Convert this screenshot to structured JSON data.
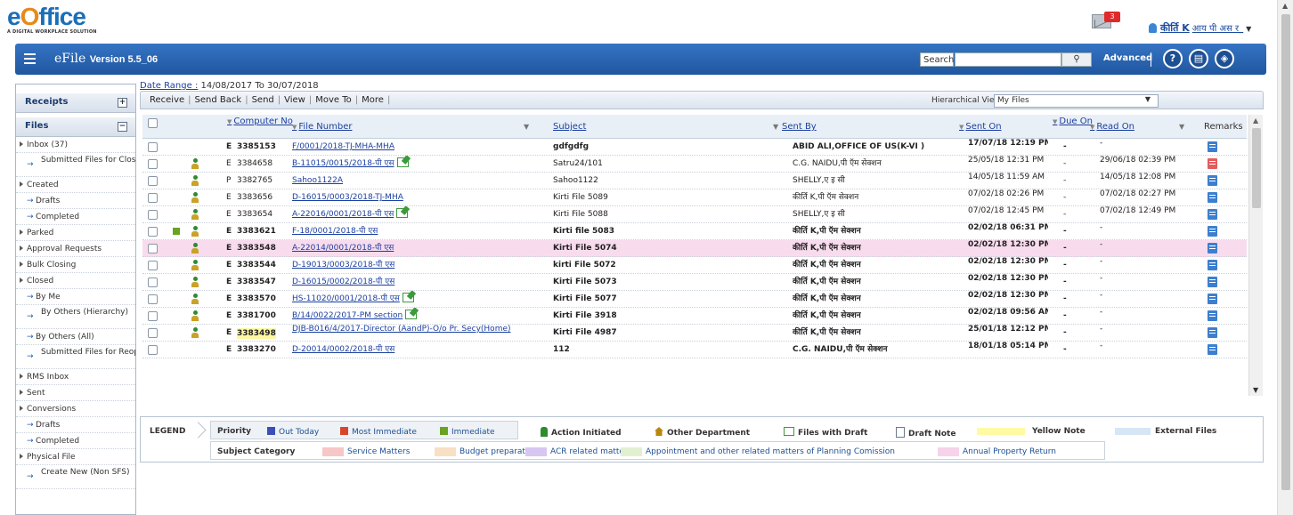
{
  "header": {
    "logo_text_e": "e",
    "logo_text_o": "O",
    "logo_text_rest": "ffice",
    "logo_tagline": "A DIGITAL WORKPLACE SOLUTION",
    "notification_count": "3",
    "user_name": "कीर्ति K",
    "user_designation": "आय पी अस र_"
  },
  "nav": {
    "app_name": "eFile",
    "version": "Version 5.5_06",
    "search_label": "Search",
    "search_value": "",
    "advanced_label": "Advanced",
    "help_icon": "?",
    "doc_icon": "▤",
    "box_icon": "◈"
  },
  "sidebar": {
    "receipts": "Receipts",
    "files": "Files",
    "items": [
      {
        "label": "Inbox (37)",
        "kind": "top"
      },
      {
        "label": "Submitted Files for Closing Approval",
        "kind": "sub2"
      },
      {
        "label": "Created",
        "kind": "top"
      },
      {
        "label": "Drafts",
        "kind": "sub"
      },
      {
        "label": "Completed",
        "kind": "sub"
      },
      {
        "label": "Parked",
        "kind": "top"
      },
      {
        "label": "Approval Requests",
        "kind": "top"
      },
      {
        "label": "Bulk Closing",
        "kind": "top"
      },
      {
        "label": "Closed",
        "kind": "top"
      },
      {
        "label": "By Me",
        "kind": "sub"
      },
      {
        "label": "By Others (Hierarchy)",
        "kind": "sub2"
      },
      {
        "label": "By Others (All)",
        "kind": "sub"
      },
      {
        "label": "Submitted Files for Reopening Approval",
        "kind": "sub2"
      },
      {
        "label": "RMS Inbox",
        "kind": "top"
      },
      {
        "label": "Sent",
        "kind": "top"
      },
      {
        "label": "Conversions",
        "kind": "top"
      },
      {
        "label": "Drafts",
        "kind": "sub"
      },
      {
        "label": "Completed",
        "kind": "sub"
      },
      {
        "label": "Physical File",
        "kind": "top"
      },
      {
        "label": "Create New (Non SFS)",
        "kind": "sub2"
      }
    ]
  },
  "filters": {
    "date_range_label": "Date Range :",
    "date_range_value": "14/08/2017 To 30/07/2018",
    "actions": [
      "Receive",
      "Send Back",
      "Send",
      "View",
      "Move To",
      "More"
    ],
    "hierarchical_label": "Hierarchical View",
    "hierarchical_value": "My Files"
  },
  "table": {
    "columns": {
      "computer_no": "Computer No",
      "file_number": "File Number",
      "subject": "Subject",
      "sent_by": "Sent By",
      "sent_on": "Sent On",
      "due_on": "Due On",
      "read_on": "Read On",
      "remarks": "Remarks"
    },
    "rows": [
      {
        "type": "E",
        "no": "3385153",
        "file": "F/0001/2018-TJ-MHA-MHA",
        "subject": "gdfgdfg",
        "sent_by": "ABID ALI,OFFICE OF US(K-VI )",
        "sent_on": "17/07/18 12:19 PM",
        "due": "-",
        "read": "-",
        "bold": true
      },
      {
        "type": "E",
        "no": "3384658",
        "file": "B-11015/0015/2018-पी एस",
        "subject": "Satru24/101",
        "sent_by": "C.G. NAIDU,पी ऍम सेक्शन",
        "sent_on": "25/05/18 12:31 PM",
        "due": "-",
        "read": "29/06/18 02:39 PM",
        "bold": false
      },
      {
        "type": "P",
        "no": "3382765",
        "file": "Sahoo1122A",
        "subject": "Sahoo1122",
        "sent_by": "SHELLY,ए इ सी",
        "sent_on": "14/05/18 11:59 AM",
        "due": "-",
        "read": "14/05/18 12:08 PM",
        "bold": false
      },
      {
        "type": "E",
        "no": "3383656",
        "file": "D-16015/0003/2018-TJ-MHA",
        "subject": "Kirti File 5089",
        "sent_by": "कीर्ति K,पी ऍम सेक्शन",
        "sent_on": "07/02/18 02:26 PM",
        "due": "-",
        "read": "07/02/18 02:27 PM",
        "bold": false
      },
      {
        "type": "E",
        "no": "3383654",
        "file": "A-22016/0001/2018-पी एस",
        "subject": "Kirti File 5088",
        "sent_by": "SHELLY,ए इ सी",
        "sent_on": "07/02/18 12:45 PM",
        "due": "-",
        "read": "07/02/18 12:49 PM",
        "bold": false
      },
      {
        "type": "E",
        "no": "3383621",
        "file": "F-18/0001/2018-पी एस",
        "subject": "Kirti file 5083",
        "sent_by": "कीर्ति K,पी ऍम सेक्शन",
        "sent_on": "02/02/18 06:31 PM",
        "due": "-",
        "read": "-",
        "bold": true
      },
      {
        "type": "E",
        "no": "3383548",
        "file": "A-22014/0001/2018-पी एस",
        "subject": "Kirti File 5074",
        "sent_by": "कीर्ति K,पी ऍम सेक्शन",
        "sent_on": "02/02/18 12:30 PM",
        "due": "-",
        "read": "-",
        "bold": true
      },
      {
        "type": "E",
        "no": "3383544",
        "file": "D-19013/0003/2018-पी एस",
        "subject": "kirti File 5072",
        "sent_by": "कीर्ति K,पी ऍम सेक्शन",
        "sent_on": "02/02/18 12:30 PM",
        "due": "-",
        "read": "-",
        "bold": true
      },
      {
        "type": "E",
        "no": "3383547",
        "file": "D-16015/0002/2018-पी एस",
        "subject": "Kirti File 5073",
        "sent_by": "कीर्ति K,पी ऍम सेक्शन",
        "sent_on": "02/02/18 12:30 PM",
        "due": "-",
        "read": "-",
        "bold": true
      },
      {
        "type": "E",
        "no": "3383570",
        "file": "HS-11020/0001/2018-पी एस",
        "subject": "Kirti File 5077",
        "sent_by": "कीर्ति K,पी ऍम सेक्शन",
        "sent_on": "02/02/18 12:30 PM",
        "due": "-",
        "read": "-",
        "bold": true
      },
      {
        "type": "E",
        "no": "3381700",
        "file": "B/14/0022/2017-PM section",
        "subject": "Kirti File 3918",
        "sent_by": "कीर्ति K,पी ऍम सेक्शन",
        "sent_on": "02/02/18 09:56 AM",
        "due": "-",
        "read": "-",
        "bold": true
      },
      {
        "type": "E",
        "no": "3383498",
        "file": "DJB-B016/4/2017-Director (AandP)-O/o Pr. Secy(Home)",
        "subject": "Kirti File 4987",
        "sent_by": "कीर्ति K,पी ऍम सेक्शन",
        "sent_on": "25/01/18 12:12 PM",
        "due": "-",
        "read": "-",
        "bold": true
      },
      {
        "type": "E",
        "no": "3383270",
        "file": "D-20014/0002/2018-पी एस",
        "subject": "112",
        "sent_by": "C.G. NAIDU,पी ऍम सेक्शन",
        "sent_on": "18/01/18 05:14 PM",
        "due": "-",
        "read": "-",
        "bold": true
      }
    ]
  },
  "legend": {
    "title": "LEGEND",
    "priority_label": "Priority",
    "priorities": [
      {
        "label": "Out Today",
        "color": "#3a4fb8"
      },
      {
        "label": "Most Immediate",
        "color": "#d9452a"
      },
      {
        "label": "Immediate",
        "color": "#6aa320"
      }
    ],
    "action_initiated": "Action Initiated",
    "other_department": "Other Department",
    "files_with_draft": "Files with Draft",
    "draft_note": "Draft Note",
    "yellow_note": "Yellow Note",
    "external_files": "External Files",
    "subject_category_label": "Subject Category",
    "categories": [
      {
        "label": "Service Matters",
        "color": "#f7c6c6"
      },
      {
        "label": "Budget preparation",
        "color": "#f8e0c4"
      },
      {
        "label": "ACR related matters",
        "color": "#d7c6f2"
      },
      {
        "label": "Appointment and other related matters of Planning Comission",
        "color": "#e2f0d2"
      },
      {
        "label": "Annual Property Return",
        "color": "#f6d3ea"
      }
    ],
    "colors": {
      "yellow_note": "#fffaa3",
      "external_files": "#d6e6f7"
    }
  }
}
